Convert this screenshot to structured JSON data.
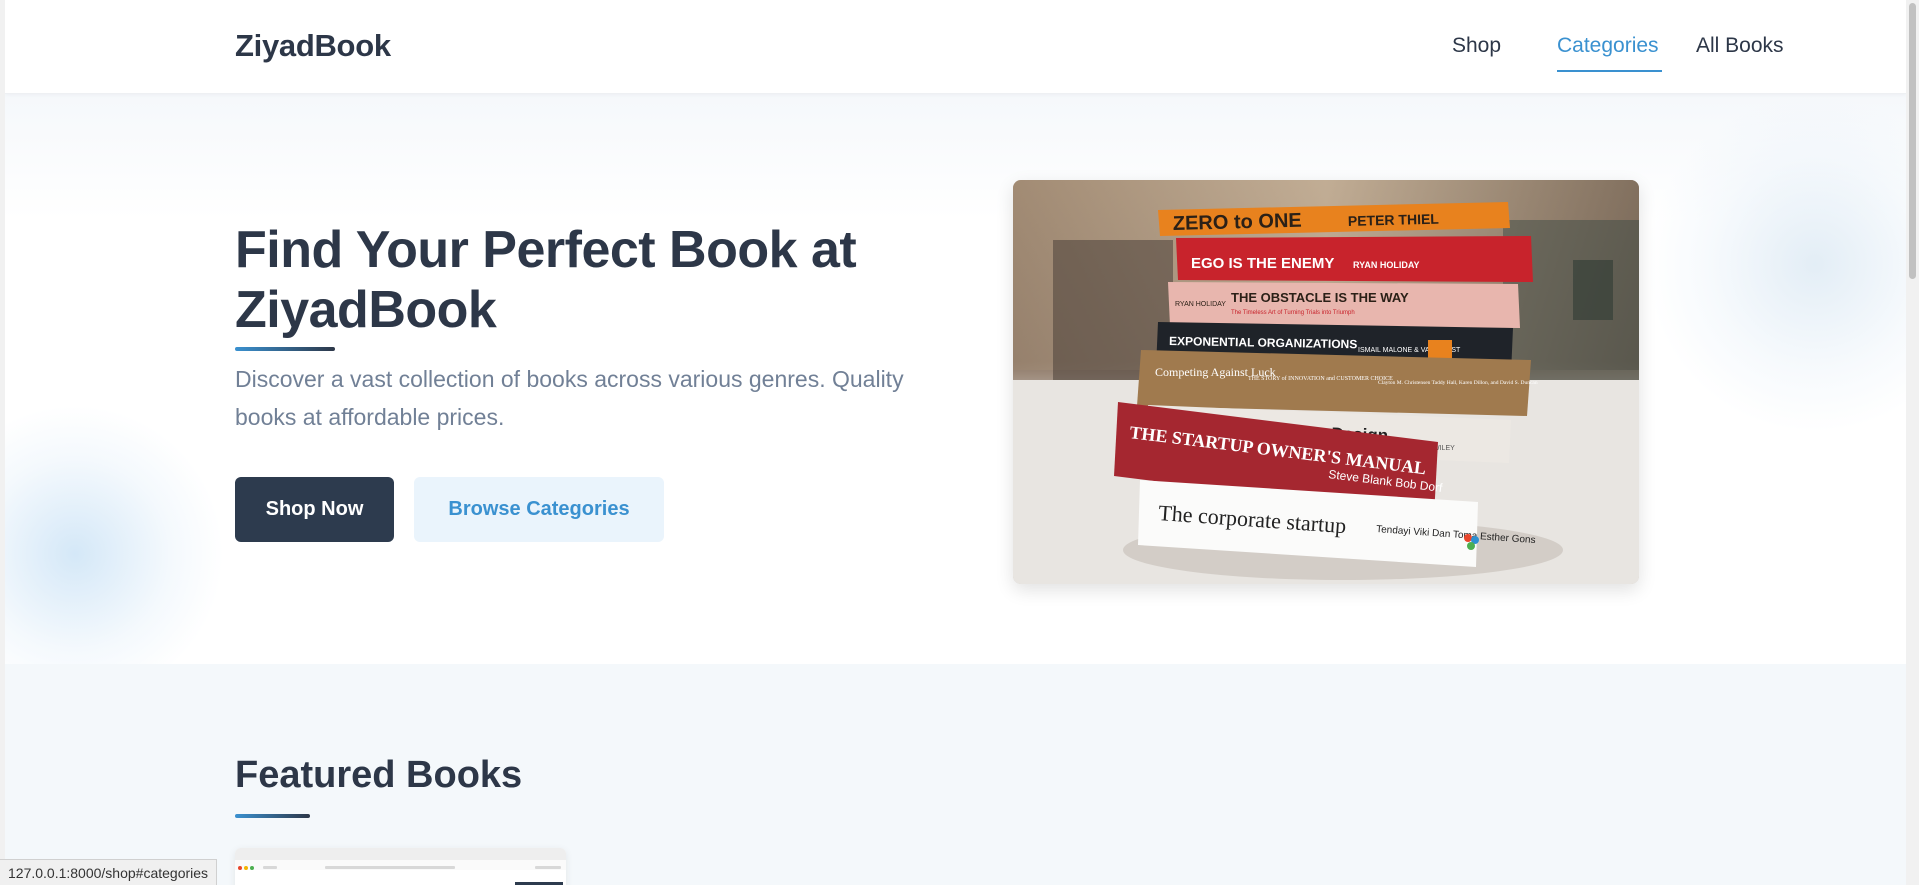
{
  "header": {
    "logo": "ZiyadBook",
    "nav": [
      {
        "label": "Shop",
        "active": false
      },
      {
        "label": "Categories",
        "active": true
      },
      {
        "label": "All Books",
        "active": false
      }
    ]
  },
  "hero": {
    "title": "Find Your Perfect Book at ZiyadBook",
    "description": "Discover a vast collection of books across various genres. Quality books at affordable prices.",
    "primary_button": "Shop Now",
    "secondary_button": "Browse Categories",
    "image": {
      "books": [
        {
          "title": "ZERO to ONE",
          "author": "PETER THIEL"
        },
        {
          "title": "EGO IS THE ENEMY",
          "author": "RYAN HOLIDAY"
        },
        {
          "title": "THE OBSTACLE IS THE WAY",
          "subtitle": "The Timeless Art of Turning Trials into Triumph",
          "author": "RYAN HOLIDAY"
        },
        {
          "title": "EXPONENTIAL ORGANIZATIONS",
          "author": "ISMAIL MALONE & VAN GEEST"
        },
        {
          "title": "Competing Against Luck",
          "subtitle": "THE STORY of INNOVATION and CUSTOMER CHOICE",
          "author": "Clayton M. Christensen Taddy Hall, Karen Dillon, and David S. Duncan"
        },
        {
          "title": "Value Proposition Design",
          "author": "WILEY"
        },
        {
          "title": "THE STARTUP OWNER'S MANUAL",
          "author": "Steve Blank Bob Dorf"
        },
        {
          "title": "The corporate startup",
          "author": "Tendayi Viki Dan Toma Esther Gons"
        }
      ]
    }
  },
  "featured": {
    "title": "Featured Books"
  },
  "status_bar": {
    "url": "127.0.0.1:8000/shop#categories"
  },
  "colors": {
    "primary_dark": "#2d3b4e",
    "accent": "#3a91d0",
    "text": "#2d3748",
    "muted": "#718096",
    "section_bg": "#f4f8fb"
  }
}
